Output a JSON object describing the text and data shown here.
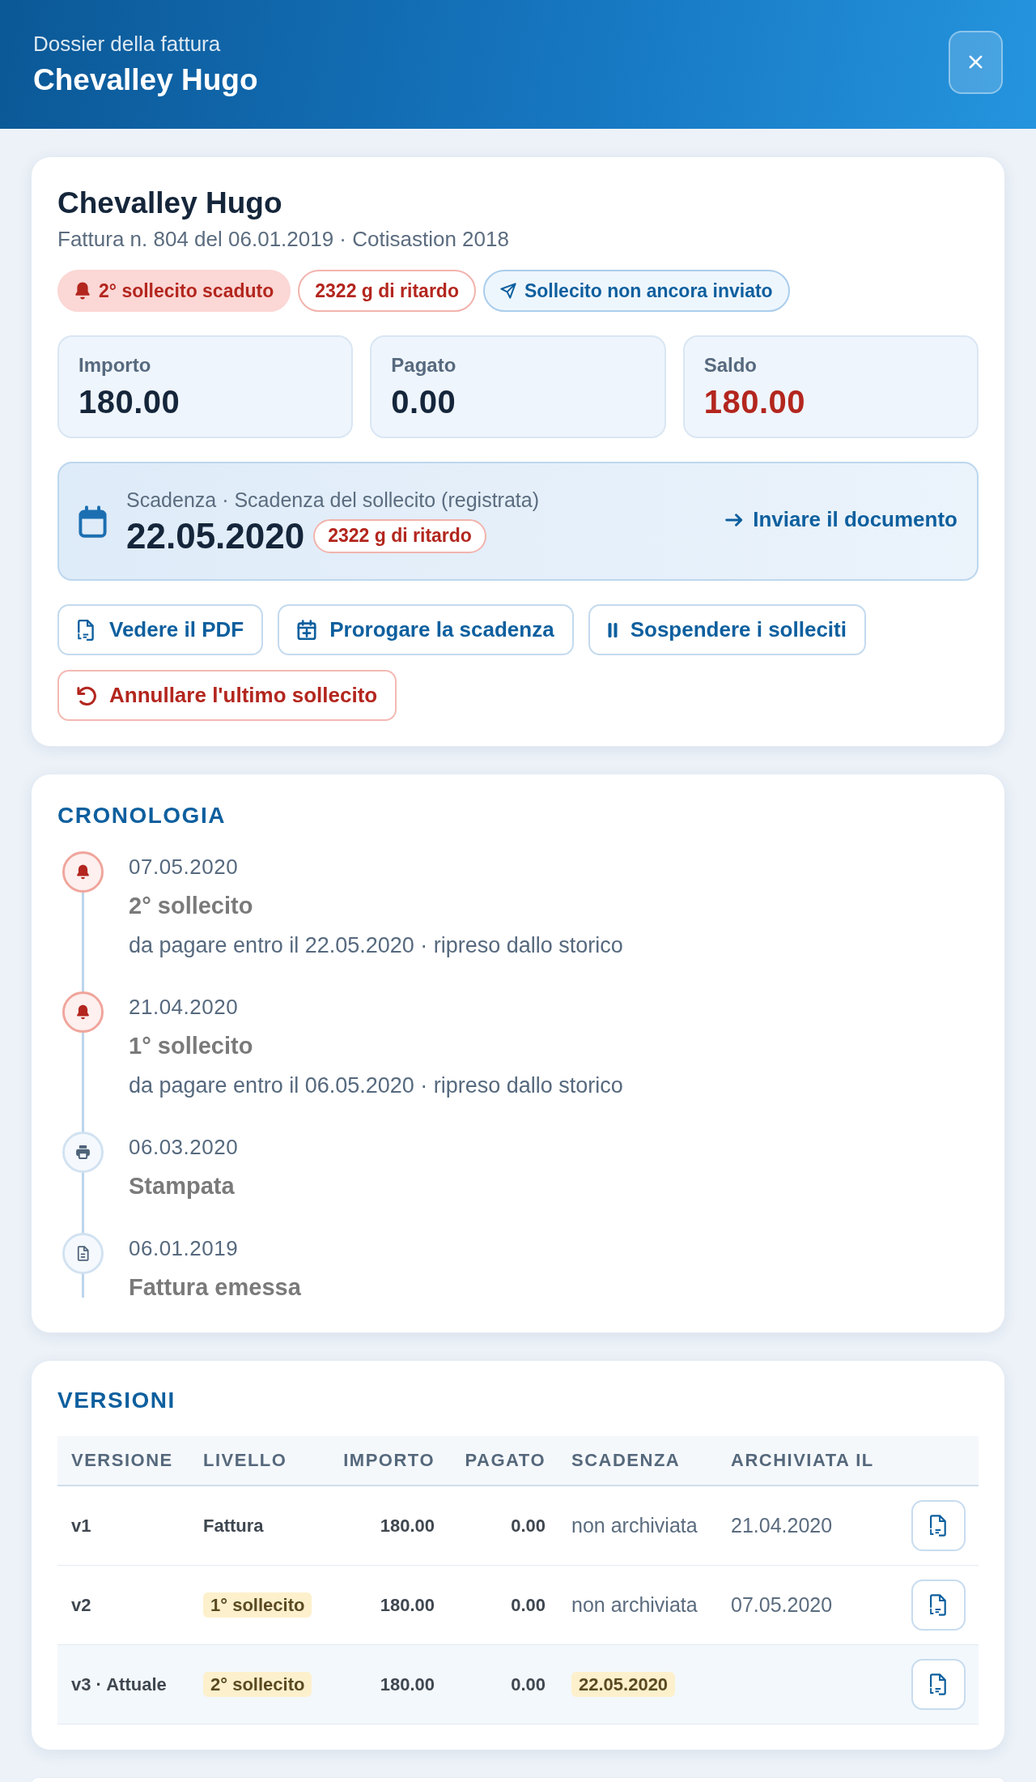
{
  "header": {
    "subtitle": "Dossier della fattura",
    "title": "Chevalley Hugo"
  },
  "invoice": {
    "name": "Chevalley Hugo",
    "subtitle": "Fattura n. 804 del 06.01.2019 · Cotisastion 2018",
    "badges": [
      {
        "kind": "alert",
        "label": "2° sollecito scaduto"
      },
      {
        "kind": "delay",
        "label": "2322 g di ritardo"
      },
      {
        "kind": "info",
        "label": "Sollecito non ancora inviato"
      }
    ],
    "amounts": [
      {
        "label": "Importo",
        "value": "180.00",
        "alert": false
      },
      {
        "label": "Pagato",
        "value": "0.00",
        "alert": false
      },
      {
        "label": "Saldo",
        "value": "180.00",
        "alert": true
      }
    ],
    "due": {
      "label": "Scadenza · Scadenza del sollecito (registrata)",
      "date": "22.05.2020",
      "delay": "2322 g di ritardo",
      "action": "Inviare il documento"
    },
    "actions": [
      {
        "kind": "pdf",
        "danger": false,
        "label": "Vedere il PDF"
      },
      {
        "kind": "extend",
        "danger": false,
        "label": "Prorogare la scadenza"
      },
      {
        "kind": "pause",
        "danger": false,
        "label": "Sospendere i solleciti"
      },
      {
        "kind": "undo",
        "danger": true,
        "label": "Annullare l'ultimo sollecito"
      }
    ]
  },
  "timeline": {
    "title": "CRONOLOGIA",
    "events": [
      {
        "kind": "reminder",
        "date": "07.05.2020",
        "title": "2° sollecito",
        "note": "da pagare entro il 22.05.2020 · ripreso dallo storico"
      },
      {
        "kind": "reminder",
        "date": "21.04.2020",
        "title": "1° sollecito",
        "note": "da pagare entro il 06.05.2020 · ripreso dallo storico"
      },
      {
        "kind": "printed",
        "date": "06.03.2020",
        "title": "Stampata"
      },
      {
        "kind": "issued",
        "date": "06.01.2019",
        "title": "Fattura emessa"
      }
    ]
  },
  "versions": {
    "title": "VERSIONI",
    "columns": [
      "VERSIONE",
      "LIVELLO",
      "IMPORTO",
      "PAGATO",
      "SCADENZA",
      "ARCHIVIATA IL"
    ],
    "rows": [
      {
        "version": "v1",
        "level": "Fattura",
        "level_highlight": false,
        "amount": "180.00",
        "paid": "0.00",
        "due": "non archiviata",
        "due_highlight": false,
        "archived_on": "21.04.2020",
        "current": false
      },
      {
        "version": "v2",
        "level": "1° sollecito",
        "level_highlight": true,
        "amount": "180.00",
        "paid": "0.00",
        "due": "non archiviata",
        "due_highlight": false,
        "archived_on": "07.05.2020",
        "current": false
      },
      {
        "version": "v3 · Attuale",
        "level": "2° sollecito",
        "level_highlight": true,
        "amount": "180.00",
        "paid": "0.00",
        "due": "22.05.2020",
        "due_highlight": true,
        "current": true
      }
    ]
  }
}
